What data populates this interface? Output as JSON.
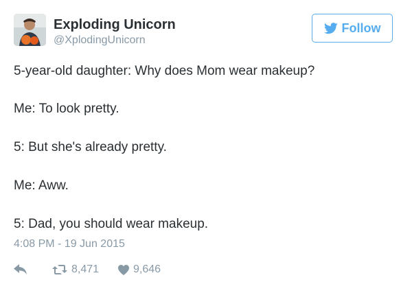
{
  "tweet": {
    "author_name": "Exploding Unicorn",
    "author_handle": "@XplodingUnicorn",
    "follow_label": "Follow",
    "lines": [
      "5-year-old daughter: Why does Mom wear makeup?",
      "Me: To look pretty.",
      "5: But she's already pretty.",
      "Me: Aww.",
      "5: Dad, you should wear makeup."
    ],
    "timestamp": "4:08 PM - 19 Jun 2015",
    "retweet_count": "8,471",
    "like_count": "9,646"
  },
  "icons": {
    "avatar": "user-avatar-photo",
    "follow": "twitter-bird-icon",
    "reply": "reply-icon",
    "retweet": "retweet-icon",
    "like": "heart-icon"
  },
  "colors": {
    "accent": "#55acee",
    "text": "#292f33",
    "muted": "#8899a6"
  }
}
